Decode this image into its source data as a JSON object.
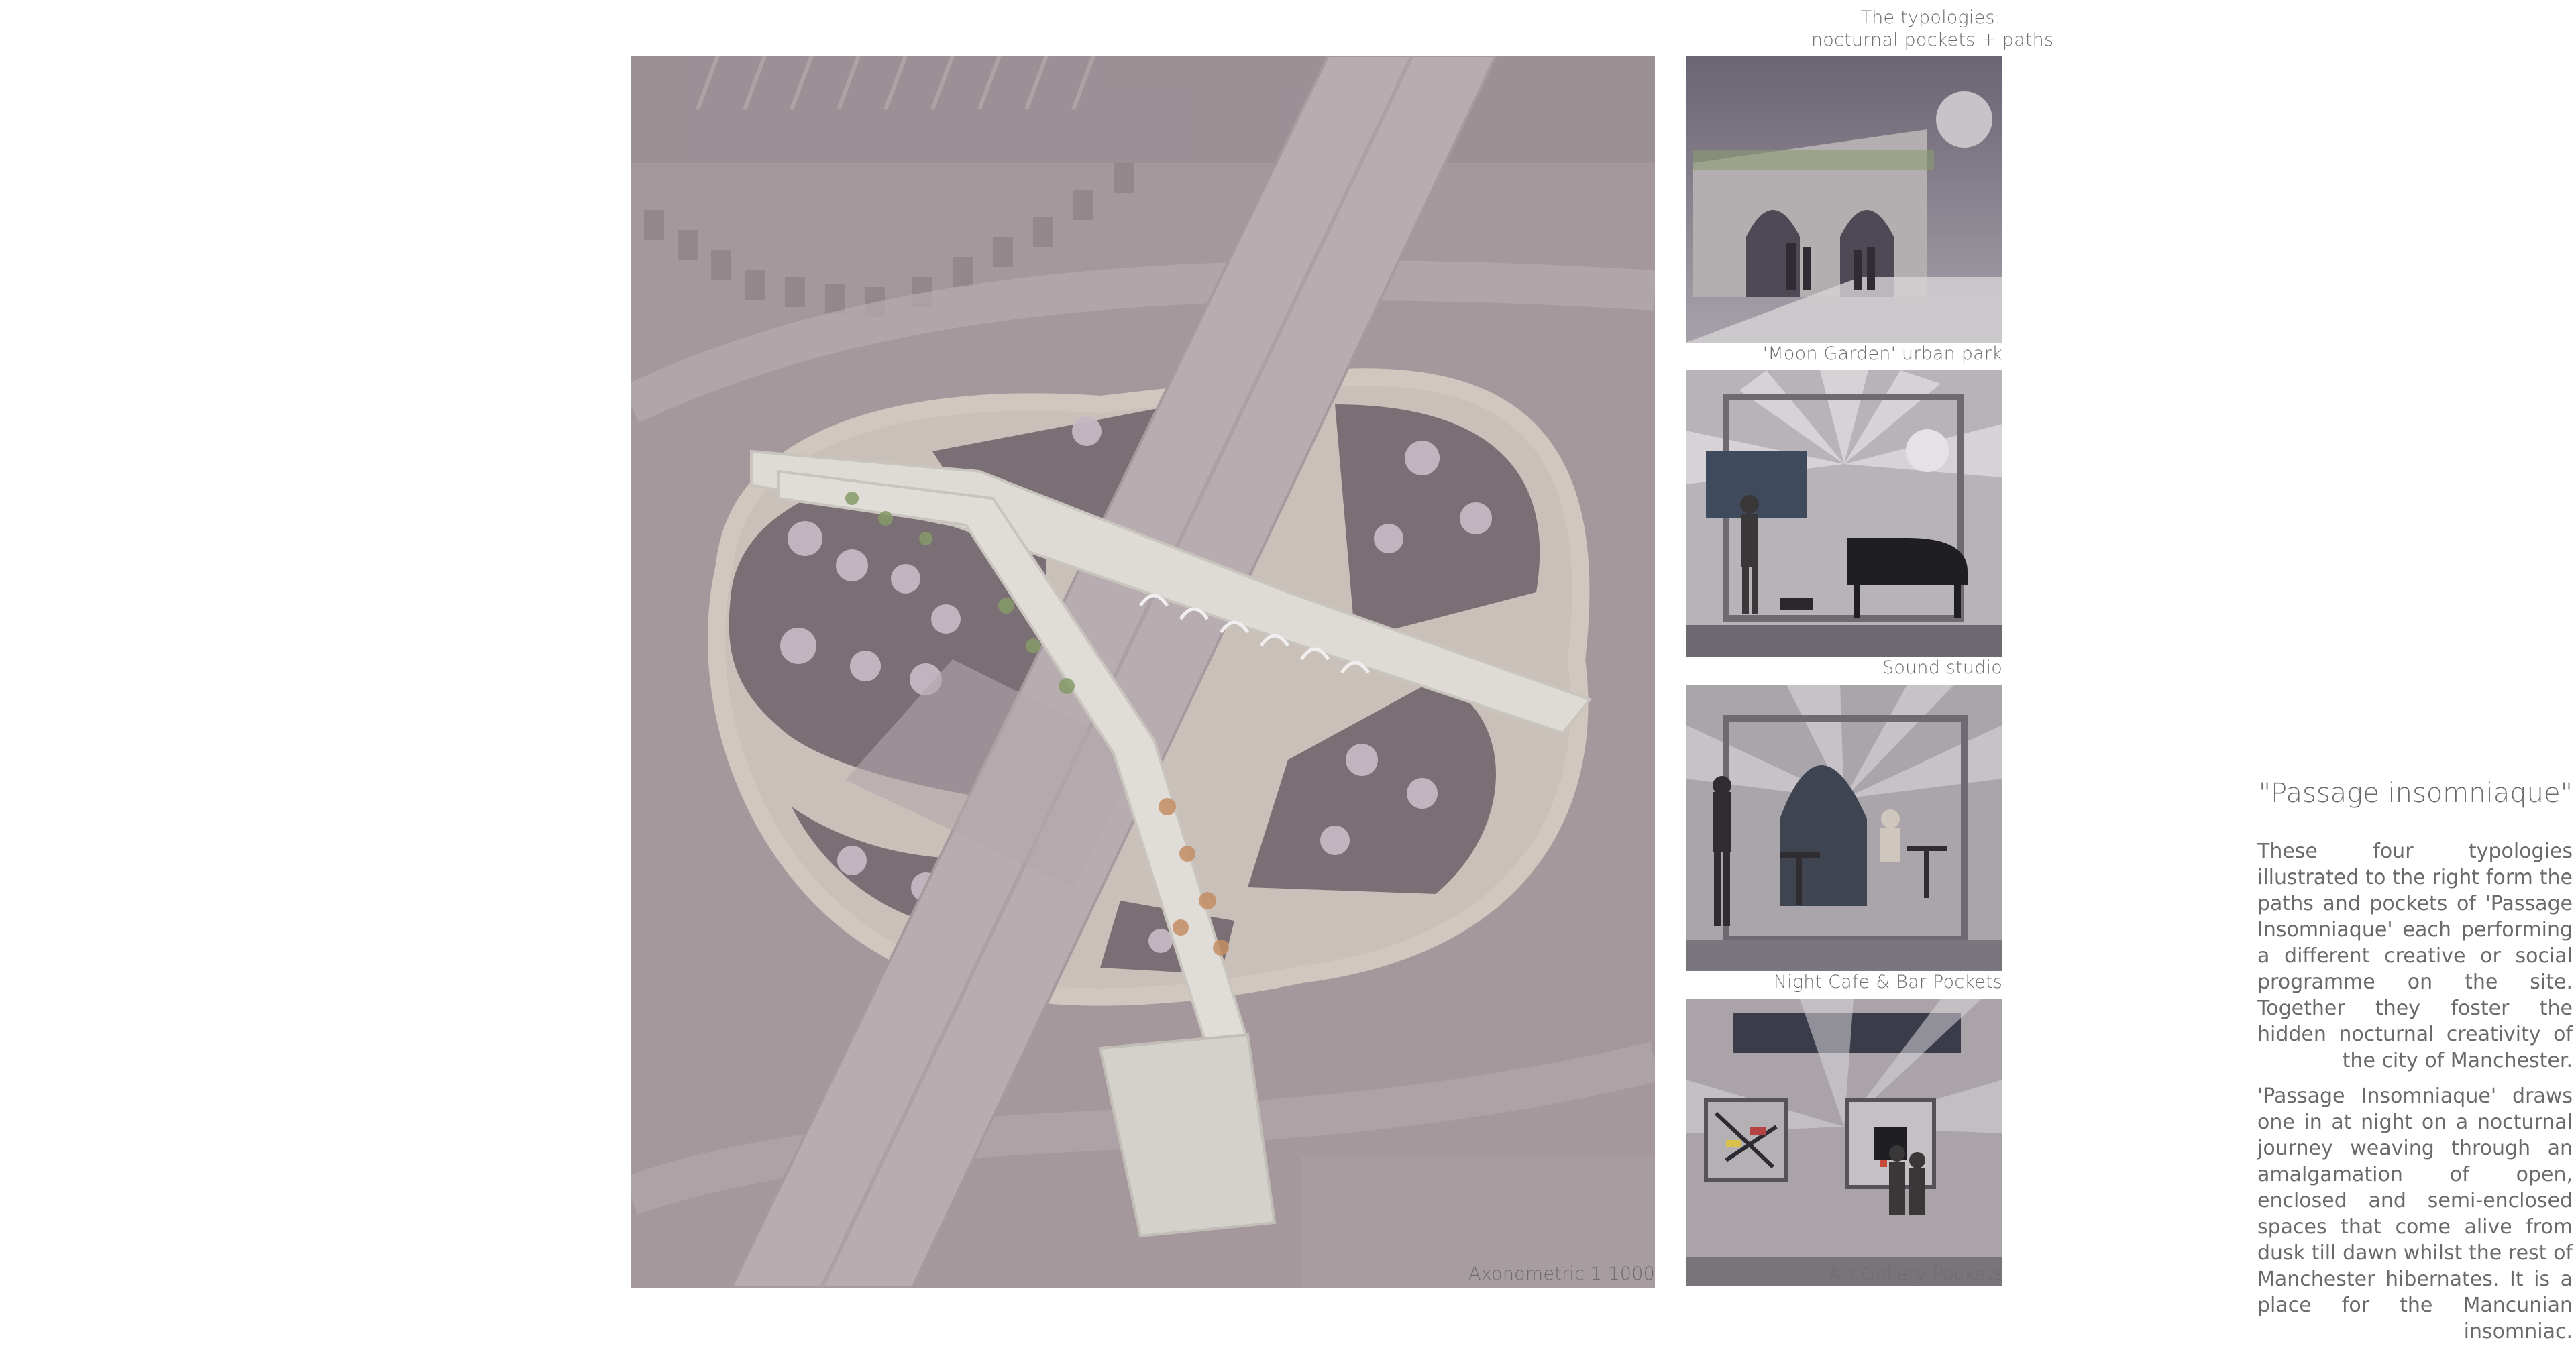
{
  "header": {
    "line1": "The typologies:",
    "line2": "nocturnal pockets + paths"
  },
  "axonometric": {
    "caption": "Axonometric 1:1000"
  },
  "typologies": [
    {
      "caption": "'Moon Garden' urban park"
    },
    {
      "caption": "Sound studio"
    },
    {
      "caption": "Night Cafe & Bar Pockets"
    },
    {
      "caption": "Art Gallery Pockets"
    }
  ],
  "statement": {
    "title": "\"Passage insomniaque\"",
    "paragraph1": "These four typologies illustrated to the right form the paths and pockets of 'Passage Insomniaque' each performing a different creative or social programme on the site. Together they foster the hidden nocturnal creativity of the city of Manchester.",
    "paragraph2": "'Passage Insomniaque' draws one in at night on a nocturnal journey weaving through an amalgamation of open, enclosed and semi-enclosed spaces that come alive from dusk till dawn whilst the rest of Manchester hibernates. It is a place for the Mancunian insomniac."
  },
  "colors": {
    "background": "#ffffff",
    "site_base": "#9f969a",
    "road": "#b3a9ac",
    "planting": "#6f6569",
    "bridge": "#e7e5dd",
    "text": "#6b6b6b"
  }
}
